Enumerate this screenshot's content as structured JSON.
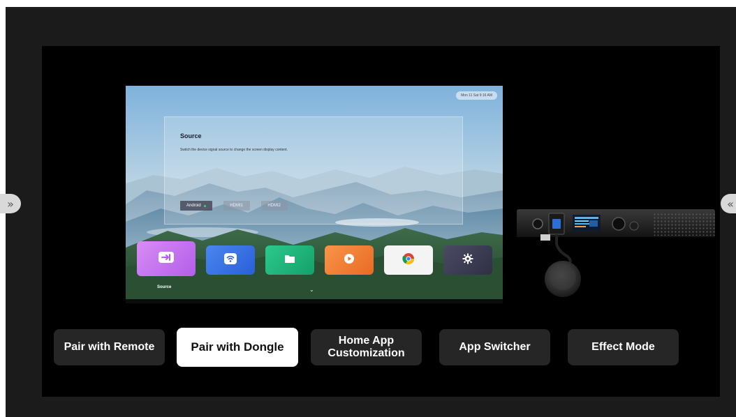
{
  "tv": {
    "status_text": "Mon 11 Sat 9:16 AM",
    "source_panel": {
      "title": "Source",
      "description": "Switch the device signal source to change the screen display content.",
      "options": [
        {
          "label": "Android",
          "active": true
        },
        {
          "label": "HDMI1",
          "active": false
        },
        {
          "label": "HDMI2",
          "active": false
        }
      ]
    },
    "dock": {
      "selected_label": "Source",
      "apps": [
        {
          "name": "source",
          "icon": "source-icon",
          "color": "#c56bf0"
        },
        {
          "name": "screen-share",
          "icon": "wifi-icon",
          "color": "#2f6fe8"
        },
        {
          "name": "files",
          "icon": "folder-icon",
          "color": "#1bb37a"
        },
        {
          "name": "media-player",
          "icon": "play-icon",
          "color": "#f07a2e"
        },
        {
          "name": "chrome",
          "icon": "chrome-icon",
          "color": "#f3f3f3"
        },
        {
          "name": "settings",
          "icon": "gear-icon",
          "color": "#3c3d52"
        }
      ]
    }
  },
  "nav": {
    "left_arrow_icon": "double-chevron-right-icon",
    "right_arrow_icon": "double-chevron-left-icon",
    "left_arrow": "»",
    "right_arrow": "«"
  },
  "tabs": [
    {
      "label": "Pair with Remote",
      "active": false
    },
    {
      "label": "Pair with Dongle",
      "active": true
    },
    {
      "label": "Home App Customization",
      "active": false
    },
    {
      "label": "App Switcher",
      "active": false
    },
    {
      "label": "Effect Mode",
      "active": false
    }
  ],
  "colors": {
    "frame": "#1b1b1b",
    "stage": "#000000",
    "tab_bg": "#262626",
    "tab_active_bg": "#ffffff",
    "status_dot": "#39d27a"
  }
}
